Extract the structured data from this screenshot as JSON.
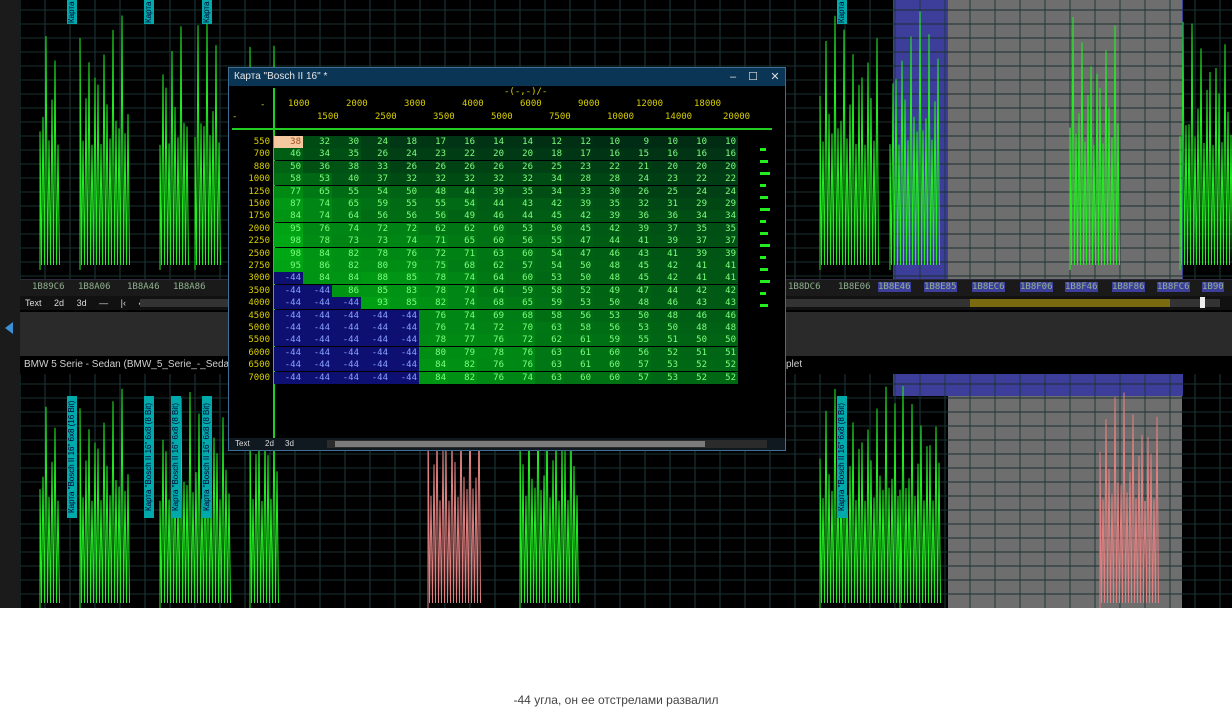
{
  "window": {
    "title": "Карта \"Bosch II 16\" *",
    "minimize_glyph": "–",
    "maximize_glyph": "☐",
    "close_glyph": "✕",
    "axis_corner": "-",
    "axis_unit": "-(-,-)/-",
    "row_header_dash": "-",
    "col_headers_top": [
      "1000",
      "2000",
      "3000",
      "4000",
      "6000",
      "9000",
      "12000",
      "18000"
    ],
    "col_headers_bottom": [
      "1500",
      "2500",
      "3500",
      "5000",
      "7500",
      "10000",
      "14000",
      "20000"
    ],
    "rows": [
      {
        "label": "550",
        "values": [
          38,
          32,
          30,
          24,
          18,
          17,
          16,
          14,
          14,
          12,
          12,
          10,
          9,
          10,
          10,
          10
        ]
      },
      {
        "label": "700",
        "values": [
          46,
          34,
          35,
          26,
          24,
          23,
          22,
          20,
          20,
          18,
          17,
          16,
          15,
          16,
          16,
          16
        ]
      },
      {
        "label": "880",
        "values": [
          50,
          36,
          38,
          33,
          26,
          26,
          26,
          26,
          26,
          25,
          23,
          22,
          21,
          20,
          20,
          20
        ]
      },
      {
        "label": "1000",
        "values": [
          58,
          53,
          40,
          37,
          32,
          32,
          32,
          32,
          32,
          34,
          28,
          28,
          24,
          23,
          22,
          22
        ]
      },
      {
        "label": "1250",
        "values": [
          77,
          65,
          55,
          54,
          50,
          48,
          44,
          39,
          35,
          34,
          33,
          30,
          26,
          25,
          24,
          24
        ]
      },
      {
        "label": "1500",
        "values": [
          87,
          74,
          65,
          59,
          55,
          55,
          54,
          44,
          43,
          42,
          39,
          35,
          32,
          31,
          29,
          29
        ]
      },
      {
        "label": "1750",
        "values": [
          84,
          74,
          64,
          56,
          56,
          56,
          49,
          46,
          44,
          45,
          42,
          39,
          36,
          36,
          34,
          34
        ]
      },
      {
        "label": "2000",
        "values": [
          95,
          76,
          74,
          72,
          72,
          62,
          62,
          60,
          53,
          50,
          45,
          42,
          39,
          37,
          35,
          35
        ]
      },
      {
        "label": "2250",
        "values": [
          98,
          78,
          73,
          73,
          74,
          71,
          65,
          60,
          56,
          55,
          47,
          44,
          41,
          39,
          37,
          37
        ]
      },
      {
        "label": "2500",
        "values": [
          98,
          84,
          82,
          78,
          76,
          72,
          71,
          63,
          60,
          54,
          47,
          46,
          43,
          41,
          39,
          39
        ]
      },
      {
        "label": "2750",
        "values": [
          95,
          86,
          82,
          80,
          79,
          75,
          68,
          62,
          57,
          54,
          50,
          48,
          45,
          42,
          41,
          41
        ]
      },
      {
        "label": "3000",
        "values": [
          -44,
          84,
          84,
          88,
          85,
          78,
          74,
          64,
          60,
          53,
          50,
          48,
          45,
          42,
          41,
          41
        ]
      },
      {
        "label": "3500",
        "values": [
          -44,
          -44,
          86,
          85,
          83,
          78,
          74,
          64,
          59,
          58,
          52,
          49,
          47,
          44,
          42,
          42
        ]
      },
      {
        "label": "4000",
        "values": [
          -44,
          -44,
          -44,
          93,
          85,
          82,
          74,
          68,
          65,
          59,
          53,
          50,
          48,
          46,
          43,
          43
        ]
      },
      {
        "label": "4500",
        "values": [
          -44,
          -44,
          -44,
          -44,
          -44,
          76,
          74,
          69,
          68,
          58,
          56,
          53,
          50,
          48,
          46,
          46
        ]
      },
      {
        "label": "5000",
        "values": [
          -44,
          -44,
          -44,
          -44,
          -44,
          76,
          74,
          72,
          70,
          63,
          58,
          56,
          53,
          50,
          48,
          48
        ]
      },
      {
        "label": "5500",
        "values": [
          -44,
          -44,
          -44,
          -44,
          -44,
          78,
          77,
          76,
          72,
          62,
          61,
          59,
          55,
          51,
          50,
          50
        ]
      },
      {
        "label": "6000",
        "values": [
          -44,
          -44,
          -44,
          -44,
          -44,
          80,
          79,
          78,
          76,
          63,
          61,
          60,
          56,
          52,
          51,
          51
        ]
      },
      {
        "label": "6500",
        "values": [
          -44,
          -44,
          -44,
          -44,
          -44,
          84,
          82,
          76,
          76,
          63,
          61,
          60,
          57,
          53,
          52,
          52
        ]
      },
      {
        "label": "7000",
        "values": [
          -44,
          -44,
          -44,
          -44,
          -44,
          84,
          82,
          76,
          74,
          63,
          60,
          60,
          57,
          53,
          52,
          52
        ]
      }
    ],
    "tabs": [
      "Text",
      "2d",
      "3d"
    ]
  },
  "main": {
    "top_addresses": [
      "1B89C6",
      "1B8A06",
      "1B8A46",
      "1B8A86",
      "1B8DC6",
      "1B8E06",
      "1B8E46",
      "1B8E85",
      "1B8EC6",
      "1B8F06",
      "1B8F46",
      "1B8F86",
      "1B8FC6",
      "1B90"
    ],
    "tabs": [
      "Text",
      "2d",
      "3d",
      "—",
      "|‹",
      "‹‹",
      "‹"
    ],
    "vehicle_title": "BMW 5 Serie - Sedan (BMW_5_Serie_-_Sedan_F",
    "vehicle_title_tail": "plet",
    "top_tags": [
      "Карта",
      "Карта",
      "Карта",
      "Карта"
    ],
    "bottom_tags": [
      "Карта \"Bosch II 16\" 6x8 (16 Bit)",
      "Карта \"Bosch II 16\" 6x8 (8 Bit)",
      "Карта \"Bosch II 16\" 6x8 (8 Bit)",
      "Карта \"Bosch II 16\" 6x8 (8 Bit)",
      "Карта \"Bosch II 16\" 6x8 (8 Bit)"
    ]
  },
  "caption": "-44 угла, он ее отстрелами развалил",
  "colors": {
    "accent_green": "#22ff22",
    "window_title": "#0b3555",
    "highlight_blue": "#3d3d9a",
    "header_yellow": "#d8d000"
  }
}
